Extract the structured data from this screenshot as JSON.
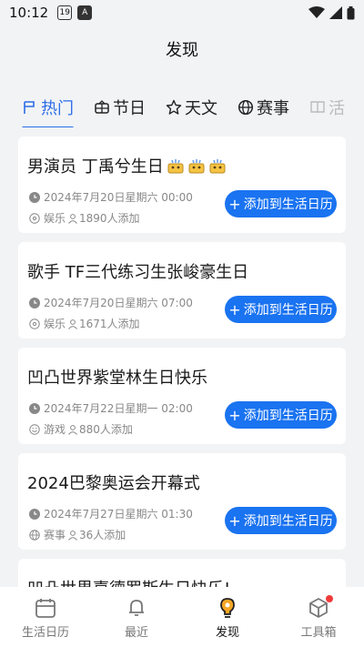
{
  "status": {
    "time": "10:12",
    "badge1": "19",
    "badge2": "A"
  },
  "header": {
    "title": "发现"
  },
  "tabs": [
    {
      "label": "热门",
      "icon": "fire-icon"
    },
    {
      "label": "节日",
      "icon": "lantern-icon"
    },
    {
      "label": "天文",
      "icon": "star-icon"
    },
    {
      "label": "赛事",
      "icon": "globe-icon"
    },
    {
      "label": "活",
      "icon": "book-icon"
    }
  ],
  "events": [
    {
      "title": "男演员 丁禹兮生日",
      "datetime": "2024年7月20日星期六 00:00",
      "category": "娱乐",
      "count": "1890人添加",
      "button": "添加到生活日历"
    },
    {
      "title": "歌手 TF三代练习生张峻豪生日",
      "datetime": "2024年7月20日星期六 07:00",
      "category": "娱乐",
      "count": "1671人添加",
      "button": "添加到生活日历"
    },
    {
      "title": "凹凸世界紫堂林生日快乐",
      "datetime": "2024年7月22日星期一 02:00",
      "category": "游戏",
      "count": "880人添加",
      "button": "添加到生活日历"
    },
    {
      "title": "2024巴黎奥运会开幕式",
      "datetime": "2024年7月27日星期六 01:30",
      "category": "赛事",
      "count": "36人添加",
      "button": "添加到生活日历"
    },
    {
      "title": "凹凸世界嘉德罗斯生日快乐!"
    }
  ],
  "nav": [
    {
      "label": "生活日历"
    },
    {
      "label": "最近"
    },
    {
      "label": "发现"
    },
    {
      "label": "工具箱"
    }
  ],
  "colors": {
    "accent": "#2b6de8",
    "button": "#1a73f0",
    "badge": "#f03a3a"
  }
}
